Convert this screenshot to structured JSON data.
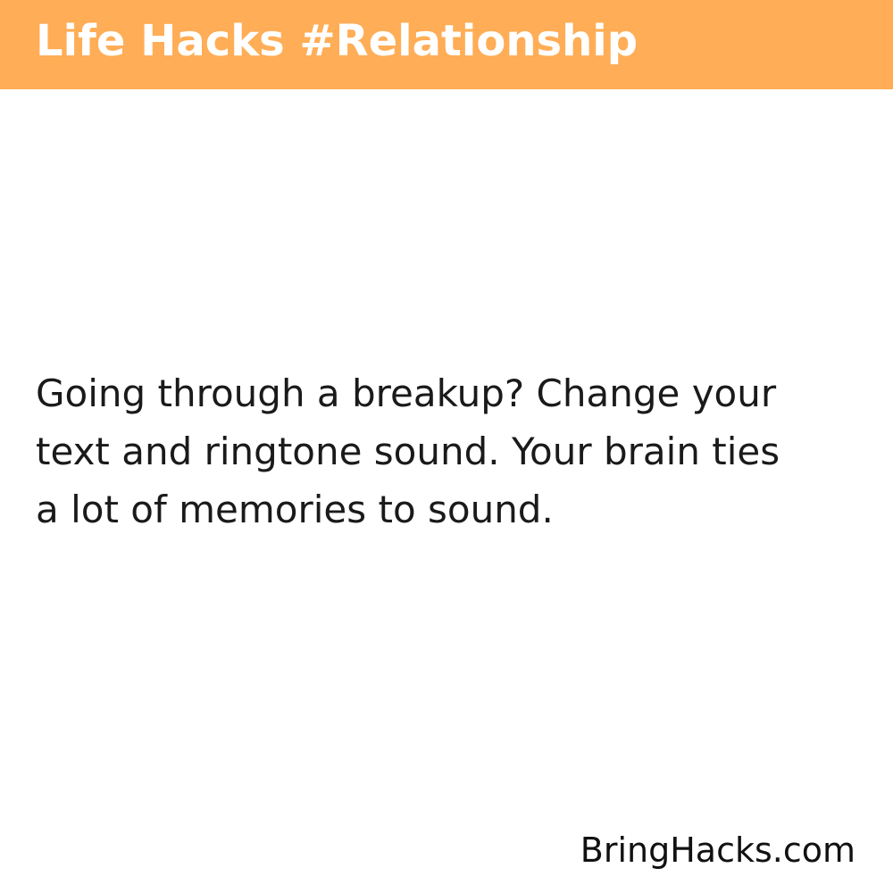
{
  "colors": {
    "header_bg": "#FFAD56",
    "header_text": "#FFFFFF",
    "body_text": "#1A1A1A",
    "background": "#FFFFFF"
  },
  "header": {
    "title": "Life Hacks #Relationship"
  },
  "tip": {
    "lines": [
      "Going through a breakup? Change your",
      "text and ringtone sound. Your brain ties",
      "a lot of memories to sound."
    ]
  },
  "footer": {
    "site": "BringHacks.com"
  }
}
